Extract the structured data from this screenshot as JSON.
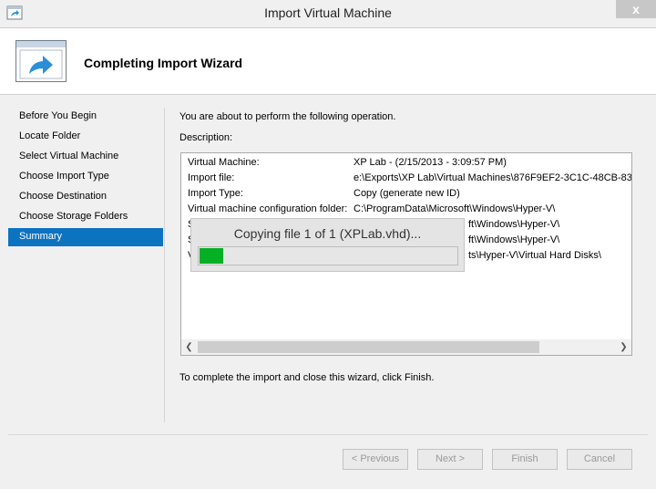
{
  "window": {
    "title": "Import Virtual Machine",
    "close_symbol": "x"
  },
  "header": {
    "title": "Completing Import Wizard"
  },
  "nav": {
    "items": [
      {
        "label": "Before You Begin"
      },
      {
        "label": "Locate Folder"
      },
      {
        "label": "Select Virtual Machine"
      },
      {
        "label": "Choose Import Type"
      },
      {
        "label": "Choose Destination"
      },
      {
        "label": "Choose Storage Folders"
      },
      {
        "label": "Summary",
        "selected": true
      }
    ]
  },
  "main": {
    "intro": "You are about to perform the following operation.",
    "description_label": "Description:",
    "rows": [
      {
        "key": "Virtual Machine:",
        "value": "XP Lab - (2/15/2013 - 3:09:57 PM)"
      },
      {
        "key": "Import file:",
        "value": "e:\\Exports\\XP Lab\\Virtual Machines\\876F9EF2-3C1C-48CB-8339"
      },
      {
        "key": "Import Type:",
        "value": "Copy (generate new ID)"
      },
      {
        "key": "Virtual machine configuration folder:",
        "value": "C:\\ProgramData\\Microsoft\\Windows\\Hyper-V\\"
      },
      {
        "key": "S",
        "value": "ft\\Windows\\Hyper-V\\"
      },
      {
        "key": "S",
        "value": "ft\\Windows\\Hyper-V\\"
      },
      {
        "key": "V",
        "value": "ts\\Hyper-V\\Virtual Hard Disks\\"
      }
    ],
    "footer": "To complete the import and close this wizard, click Finish."
  },
  "progress": {
    "text": "Copying file 1 of 1 (XPLab.vhd)...",
    "percent": 9
  },
  "buttons": {
    "previous": "< Previous",
    "next": "Next >",
    "finish": "Finish",
    "cancel": "Cancel"
  },
  "colors": {
    "selection": "#0c73c1",
    "progress": "#06b025"
  },
  "icons": {
    "app": "vm-import-arrow-icon",
    "wizard": "window-arrow-icon",
    "close": "close-icon"
  }
}
